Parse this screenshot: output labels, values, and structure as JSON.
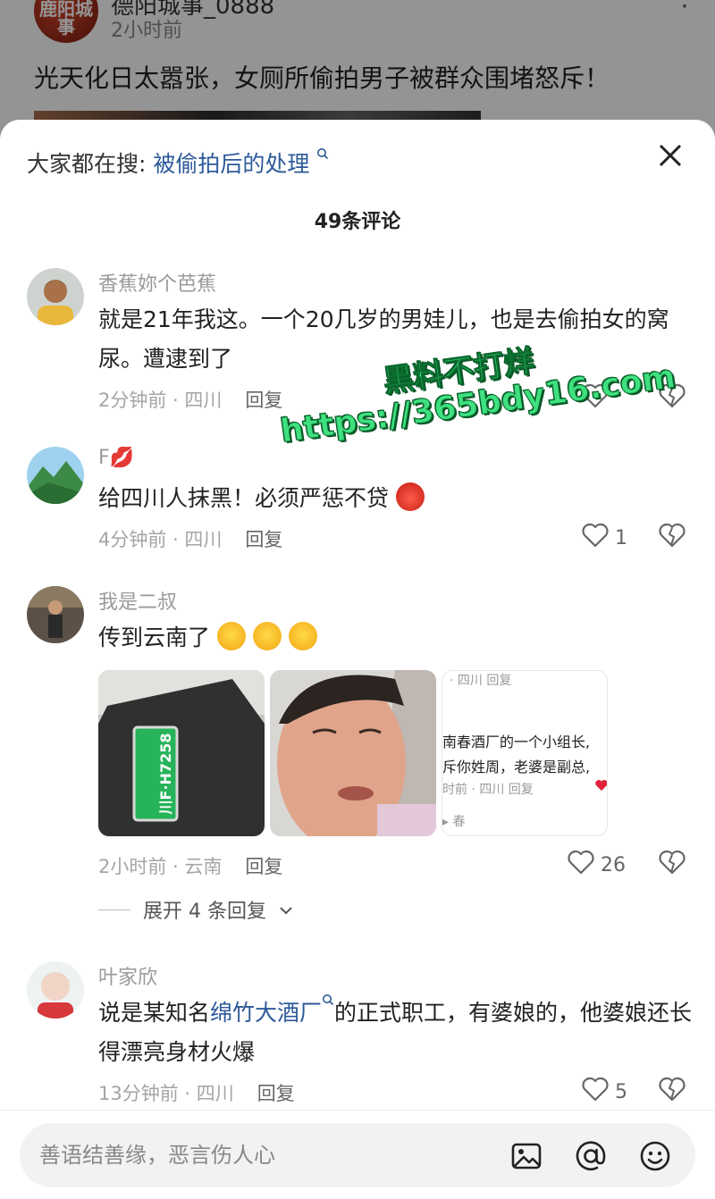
{
  "background_post": {
    "avatar_text": "鹿阳城事",
    "author": "德阳城事_0888",
    "time": "2小时前",
    "more": "⋮",
    "title": "光天化日太嚣张，女厕所偷拍男子被群众围堵怒斥！"
  },
  "sheet": {
    "search_prefix": "大家都在搜:",
    "search_link": "被偷拍后的处理",
    "title": "49条评论"
  },
  "comments": [
    {
      "username": "香蕉妳个芭蕉",
      "text": "就是21年我这。一个20几岁的男娃儿，也是去偷拍女的窝尿。遭逮到了",
      "time_location": "2分钟前 · 四川",
      "reply": "回复",
      "likes": ""
    },
    {
      "username": "F💋",
      "text": "给四川人抹黑！必须严惩不贷",
      "time_location": "4分钟前 · 四川",
      "reply": "回复",
      "likes": "1"
    },
    {
      "username": "我是二叔",
      "text": "传到云南了",
      "time_location": "2小时前 · 云南",
      "reply": "回复",
      "likes": "26",
      "expand": "展开 4 条回复"
    },
    {
      "username": "叶家欣",
      "text_pre": "说是某知名",
      "text_link": "绵竹大酒厂",
      "text_post": "的正式职工，有婆娘的，他婆娘还长得漂亮身材火爆",
      "time_location": "13分钟前 · 四川",
      "reply": "回复",
      "likes": "5"
    }
  ],
  "thumbnails": {
    "plate": "川F·H7258",
    "third_header": "· 四川   回复",
    "third_line1": "南春酒厂的一个小组长,",
    "third_line2": "斥你姓周，老婆是副总,",
    "third_meta": "时前 · 四川   回复",
    "third_footer": "▸ 春"
  },
  "watermark": {
    "line1": "黑料不打烊",
    "line2": "https://365bdy16.com"
  },
  "input": {
    "placeholder": "善语结善缘，恶言伤人心"
  },
  "icons": [
    "close-icon",
    "heart-icon",
    "broken-heart-icon",
    "image-icon",
    "at-icon",
    "emoji-icon",
    "chevron-down-icon"
  ],
  "colors": {
    "link": "#2d5a9a",
    "watermark": "#3ee07f"
  }
}
